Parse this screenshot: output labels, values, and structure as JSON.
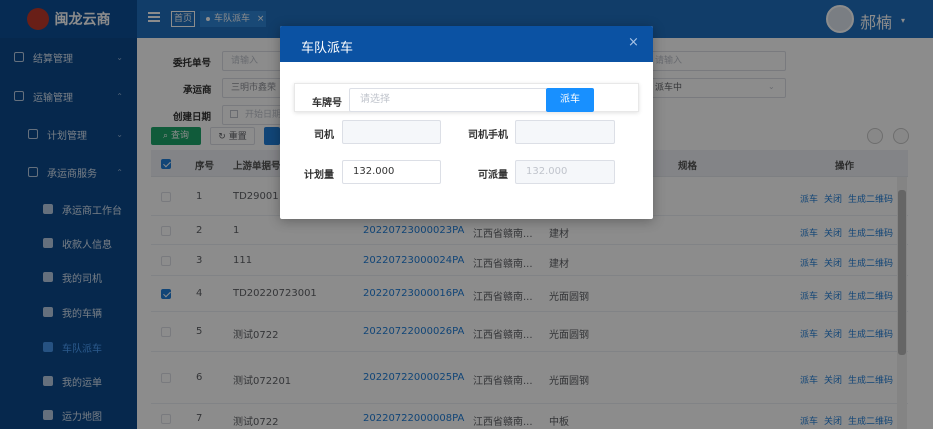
{
  "header": {
    "logo_text": "闽龙云商",
    "tab_home": "首页",
    "tab_active": "车队派车",
    "tab_close": "×",
    "username": "郝楠",
    "caret": "▾"
  },
  "sidebar": {
    "items": [
      {
        "label": "结算管理",
        "chev": "⌄"
      },
      {
        "label": "运输管理",
        "chev": "⌃"
      },
      {
        "label": "计划管理",
        "chev": "⌄"
      },
      {
        "label": "承运商服务",
        "chev": "⌃"
      },
      {
        "label": "承运商工作台"
      },
      {
        "label": "收款人信息"
      },
      {
        "label": "我的司机"
      },
      {
        "label": "我的车辆"
      },
      {
        "label": "车队派车"
      },
      {
        "label": "我的运单"
      },
      {
        "label": "运力地图"
      }
    ]
  },
  "filters": {
    "order_no_label": "委托单号",
    "order_no_placeholder": "请输入",
    "carrier_label": "承运商",
    "carrier_value": "三明市鑫荣",
    "created_label": "创建日期",
    "created_placeholder": "开始日期",
    "right_input_placeholder": "请输入",
    "right_select_value": "派车中",
    "query_label": "查询",
    "reset_label": "重置"
  },
  "table": {
    "headers": {
      "index": "序号",
      "upstream": "上游单据号",
      "spec": "规格",
      "ops": "操作"
    },
    "ops_labels": [
      "派车",
      "关闭",
      "生成二维码"
    ],
    "rows": [
      {
        "index": "1",
        "upstream": "TD29001",
        "order": "",
        "region": "",
        "spec": "",
        "checked": false
      },
      {
        "index": "2",
        "upstream": "1",
        "order": "20220723000023PA",
        "region": "江西省赣南...",
        "spec": "建材",
        "checked": false
      },
      {
        "index": "3",
        "upstream": "111",
        "order": "20220723000024PA",
        "region": "江西省赣南...",
        "spec": "建材",
        "checked": false
      },
      {
        "index": "4",
        "upstream": "TD20220723001",
        "order": "20220723000016PA",
        "region": "江西省赣南...",
        "spec": "光面圆钢",
        "checked": true
      },
      {
        "index": "5",
        "upstream": "测试0722",
        "order": "20220722000026PA",
        "region": "江西省赣南...",
        "spec": "光面圆钢",
        "checked": false
      },
      {
        "index": "6",
        "upstream": "测试072201",
        "order": "20220722000025PA",
        "region": "江西省赣南...",
        "spec": "光面圆钢",
        "checked": false
      },
      {
        "index": "7",
        "upstream": "测试0722",
        "order": "20220722000008PA",
        "region": "江西省赣南...",
        "spec": "中板",
        "checked": false
      }
    ]
  },
  "modal": {
    "title": "车队派车",
    "close": "×",
    "plate_label": "车牌号",
    "plate_placeholder": "请选择",
    "dispatch_label": "派车",
    "driver_label": "司机",
    "driver_value": "",
    "driver_phone_label": "司机手机",
    "driver_phone_value": "",
    "plan_qty_label": "计划量",
    "plan_qty_value": "132.000",
    "avail_qty_label": "可派量",
    "avail_qty_value": "132.000"
  }
}
